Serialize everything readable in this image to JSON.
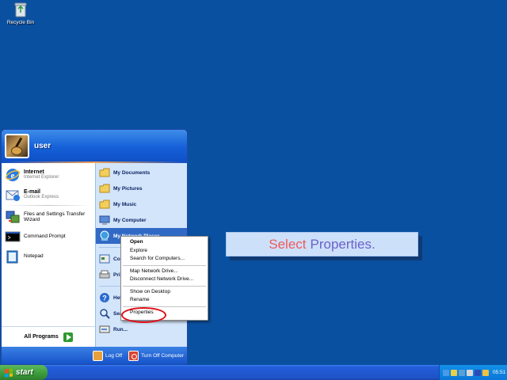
{
  "desktop": {
    "icons": [
      {
        "label": "Recycle Bin",
        "icon": "recycle-bin-icon"
      }
    ]
  },
  "start_menu": {
    "user": "user",
    "left_pinned": [
      {
        "title": "Internet",
        "subtitle": "Internet Explorer",
        "icon": "internet-explorer-icon"
      },
      {
        "title": "E-mail",
        "subtitle": "Outlook Express",
        "icon": "outlook-express-icon"
      }
    ],
    "left_recent": [
      {
        "label": "Files and Settings Transfer Wizard",
        "icon": "transfer-wizard-icon"
      },
      {
        "label": "Command Prompt",
        "icon": "command-prompt-icon"
      },
      {
        "label": "Notepad",
        "icon": "notepad-icon"
      }
    ],
    "all_programs": "All Programs",
    "right_items": [
      {
        "label": "My Documents",
        "icon": "folder-icon"
      },
      {
        "label": "My Pictures",
        "icon": "folder-icon"
      },
      {
        "label": "My Music",
        "icon": "folder-icon"
      },
      {
        "label": "My Computer",
        "icon": "computer-icon"
      },
      {
        "label": "My Network Places",
        "icon": "network-icon"
      },
      {
        "label": "Cor",
        "icon": "control-panel-icon"
      },
      {
        "label": "Prin",
        "icon": "printer-icon"
      },
      {
        "label": "Hel",
        "icon": "help-icon"
      },
      {
        "label": "Sea",
        "icon": "search-icon"
      },
      {
        "label": "Run...",
        "icon": "run-icon"
      }
    ],
    "footer": {
      "log_off": "Log Off",
      "turn_off": "Turn Off Computer"
    }
  },
  "context_menu": {
    "groups": [
      [
        "Open",
        "Explore",
        "Search for Computers..."
      ],
      [
        "Map Network Drive...",
        "Disconnect Network Drive..."
      ],
      [
        "Show on Desktop",
        "Rename"
      ],
      [
        "Properties"
      ]
    ]
  },
  "callout": {
    "word1": "Select",
    "word2": "Properties."
  },
  "taskbar": {
    "start_label": "start",
    "clock": "05:51"
  },
  "colors": {
    "desktop": "#0A50A0",
    "highlight": "#316AC5",
    "callout_red": "#F05A5A",
    "callout_blue": "#6B62C9",
    "circle": "#E0101A"
  }
}
